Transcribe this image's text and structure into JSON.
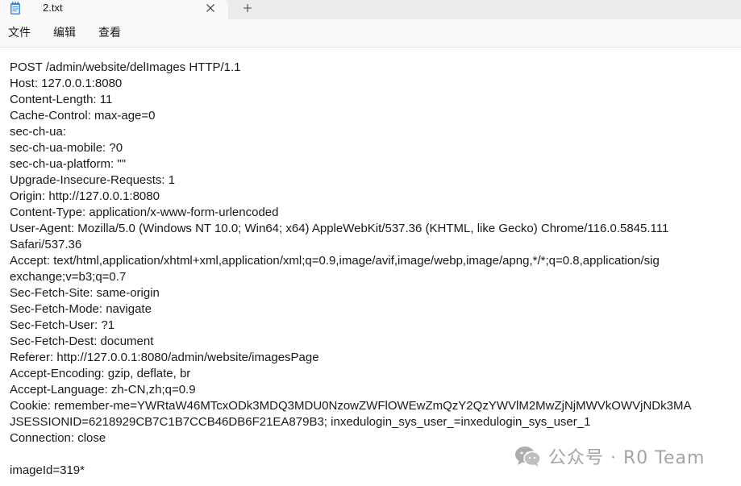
{
  "tab": {
    "title": "2.txt",
    "file_icon": "notepad-icon",
    "close_icon": "close-icon",
    "new_tab_icon": "plus-icon"
  },
  "menu": {
    "items": [
      "文件",
      "编辑",
      "查看"
    ]
  },
  "document": {
    "lines": [
      "POST /admin/website/delImages HTTP/1.1",
      "Host: 127.0.0.1:8080",
      "Content-Length: 11",
      "Cache-Control: max-age=0",
      "sec-ch-ua:",
      "sec-ch-ua-mobile: ?0",
      "sec-ch-ua-platform: \"\"",
      "Upgrade-Insecure-Requests: 1",
      "Origin: http://127.0.0.1:8080",
      "Content-Type: application/x-www-form-urlencoded",
      "User-Agent: Mozilla/5.0 (Windows NT 10.0; Win64; x64) AppleWebKit/537.36 (KHTML, like Gecko) Chrome/116.0.5845.111",
      "Safari/537.36",
      "Accept: text/html,application/xhtml+xml,application/xml;q=0.9,image/avif,image/webp,image/apng,*/*;q=0.8,application/sig",
      "exchange;v=b3;q=0.7",
      "Sec-Fetch-Site: same-origin",
      "Sec-Fetch-Mode: navigate",
      "Sec-Fetch-User: ?1",
      "Sec-Fetch-Dest: document",
      "Referer: http://127.0.0.1:8080/admin/website/imagesPage",
      "Accept-Encoding: gzip, deflate, br",
      "Accept-Language: zh-CN,zh;q=0.9",
      "Cookie: remember-me=YWRtaW46MTcxODk3MDQ3MDU0NzowZWFlOWEwZmQzY2QzYWVlM2MwZjNjMWVkOWVjNDk3MA",
      "JSESSIONID=6218929CB7C1B7CCB46DB6F21EA879B3; inxedulogin_sys_user_=inxedulogin_sys_user_1",
      "Connection: close",
      "",
      "imageId=319*"
    ]
  },
  "watermark": {
    "text": "公众号 · R0 Team",
    "logo_icon": "wechat-icon"
  }
}
